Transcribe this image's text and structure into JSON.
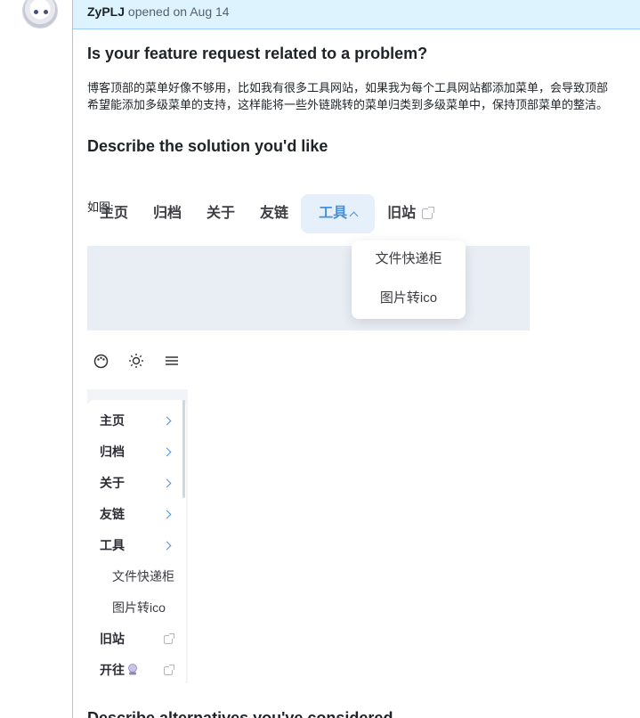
{
  "header": {
    "author": "ZyPLJ",
    "meta": "opened on Aug 14"
  },
  "sections": {
    "problem_title": "Is your feature request related to a problem?",
    "problem_line1": "博客顶部的菜单好像不够用，比如我有很多工具网站，如果我为每个工具网站都添加菜单，会导致顶部",
    "problem_line2": "希望能添加多级菜单的支持，这样能将一些外链跳转的菜单归类到多级菜单中，保持顶部菜单的整洁。",
    "solution_title": "Describe the solution you'd like",
    "solution_caption": "如图:",
    "alternatives_title": "Describe alternatives you've considered"
  },
  "nav": {
    "items": [
      "主页",
      "归档",
      "关于",
      "友链",
      "工具",
      "旧站"
    ],
    "dropdown": [
      "文件快递柜",
      "图片转ico"
    ]
  },
  "toolbar": {
    "icons": [
      "palette-icon",
      "sun-icon",
      "menu-icon"
    ]
  },
  "sidebar": {
    "items": [
      "主页",
      "归档",
      "关于",
      "友链",
      "工具"
    ],
    "sub_items": [
      "文件快递柜",
      "图片转ico"
    ],
    "ext_items": [
      "旧站",
      "开往"
    ]
  },
  "colors": {
    "accent": "#4a90d9",
    "header_bg": "#ddf4ff",
    "border": "#9ecbff"
  }
}
